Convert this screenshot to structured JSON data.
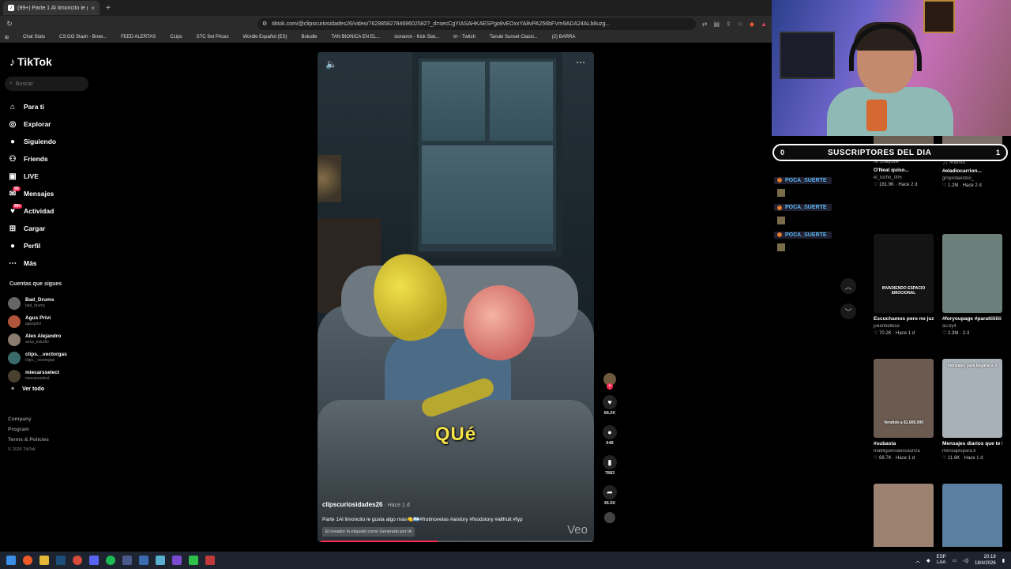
{
  "browser": {
    "tab_title": "(99+) Parte 1 Al limoncito le g...",
    "tab_close": "×",
    "new_tab": "+",
    "url": "tiktok.com/@clipscuriosidades26/video/7629858278469602582?_d=secCgYIASAHKAESPgo8vEOxxYA8vPA256bFVm9ADA24ALb8uzg...",
    "bookmarks": [
      {
        "label": "Chat Stats",
        "color": "#6a5acd"
      },
      {
        "label": "CS:GO Stash - Brow...",
        "color": "#e0a020"
      },
      {
        "label": "FEED ALERTAS",
        "color": "#e04040"
      },
      {
        "label": "CLips",
        "color": "#4a6ad0"
      },
      {
        "label": "STC Set Prices",
        "color": "#40a0c0"
      },
      {
        "label": "Wordle Español (ES)",
        "color": "#60b040"
      },
      {
        "label": "Boludle",
        "color": "#4090e0"
      },
      {
        "label": "TAN BIONICA EN EL...",
        "color": "#e04060"
      },
      {
        "label": "sionaron - Kick Stat...",
        "color": "#50c050"
      },
      {
        "label": "trr - Twitch",
        "color": "#9146ff"
      },
      {
        "label": "Tanuki Sunset Classi...",
        "color": "#e09040"
      },
      {
        "label": "(2) BARRA",
        "color": "#e03030"
      }
    ]
  },
  "tiktok": {
    "logo": "TikTok",
    "search_placeholder": "Buscar",
    "nav": [
      {
        "label": "Para ti",
        "icon": "home-icon",
        "glyph": "⌂",
        "name": "nav-for-you"
      },
      {
        "label": "Explorar",
        "icon": "compass-icon",
        "glyph": "◎",
        "name": "nav-explore"
      },
      {
        "label": "Siguiendo",
        "icon": "following-avatar-icon",
        "glyph": "●",
        "name": "nav-following"
      },
      {
        "label": "Friends",
        "icon": "friends-icon",
        "glyph": "⚇",
        "name": "nav-friends"
      },
      {
        "label": "LIVE",
        "icon": "live-icon",
        "glyph": "▣",
        "name": "nav-live"
      },
      {
        "label": "Mensajes",
        "icon": "messages-icon",
        "glyph": "✉",
        "name": "nav-messages",
        "badge": "99"
      },
      {
        "label": "Actividad",
        "icon": "activity-icon",
        "glyph": "♥",
        "name": "nav-activity",
        "badge": "99+"
      },
      {
        "label": "Cargar",
        "icon": "upload-icon",
        "glyph": "⊞",
        "name": "nav-upload"
      },
      {
        "label": "Perfil",
        "icon": "profile-avatar-icon",
        "glyph": "●",
        "name": "nav-profile"
      },
      {
        "label": "Más",
        "icon": "more-icon",
        "glyph": "⋯",
        "name": "nav-more"
      }
    ],
    "following_title": "Cuentas que sigues",
    "following": [
      {
        "name": "Bad_Drums",
        "handle": "bad_drums",
        "color": "#666"
      },
      {
        "name": "Agus Privi",
        "handle": "agusprivi",
        "color": "#b0553a"
      },
      {
        "name": "Alex Alejandro",
        "handle": "aoca_estudio",
        "color": "#8a7c6e"
      },
      {
        "name": "clips._.vectorgas",
        "handle": "clips._.vectorgas",
        "color": "#3a6a6a"
      },
      {
        "name": "miecarsselect",
        "handle": "miecarsselect",
        "color": "#4a4030"
      }
    ],
    "see_all": "Ver todo",
    "footer": [
      "Company",
      "Program",
      "Terms & Policies"
    ],
    "copyright": "© 2026 TikTok"
  },
  "video": {
    "caption_overlay": "QUé",
    "author": "clipscuriosidades26",
    "time": " · Hace 1 d",
    "description": "Parte 1Al limoncito le gusta algo mas🍋🇦🇷#frutinovelas #aistory #foodstory #allfruit #fyp",
    "ai_label": "El creador lo etiquetó como Generado por IA",
    "watermark": "Veo",
    "progress_fraction": 0.43,
    "likes": "68.2K",
    "comments": "648",
    "saves": "7883",
    "shares": "46.5K"
  },
  "stream": {
    "subs_count": "0",
    "subs_title": "SUSCRIPTORES DEL DIA",
    "subs_end": "1",
    "chat": [
      {
        "user": "POCA_SUERTE"
      },
      {
        "user": "POCA_SUERTE"
      },
      {
        "user": "POCA_SUERTE"
      }
    ]
  },
  "grid": [
    {
      "caption": "O'Neal quiso...",
      "author": "el_lucho_005",
      "stats": "♡ 181.9K · Hace 2 d",
      "top": "Ni Shaquille",
      "color": "#6b5e53"
    },
    {
      "caption": "#eladiocarrion...",
      "author": "grnjordaestoo_",
      "stats": "♡ 1.2M · Hace 2 d",
      "top": "🎵 #humor",
      "color": "#7b6f69"
    },
    {
      "caption": "Escuchamos pero no juzgamos.. 😂...",
      "author": "julianbellese",
      "stats": "♡ 70.2K · Hace 1 d",
      "overlay": "INVADIENDO ESPACIO EMOCIONAL",
      "color": "#141414"
    },
    {
      "caption": "#foryoupage #paratiiiiiiii #fy...",
      "author": "au.ky4",
      "stats": "♡ 2.3M · 2-3",
      "color": "#6d7f7a"
    },
    {
      "caption": "#subasta",
      "author": "matifigueroaescauriza",
      "stats": "♡ 68.7K · Hace 1 d",
      "overlay": "Vendido a $1.600.000",
      "color": "#6a5a50"
    },
    {
      "caption": "Mensajes diarios que te llegan",
      "author": "mensajespara.ti",
      "stats": "♡ 11.8K · Hace 1 d",
      "overlay": "mensajes para llegarte a ti",
      "color": "#a9b1b8"
    },
    {
      "caption": "",
      "author": "",
      "stats": "",
      "color": "#9c8270"
    },
    {
      "caption": "",
      "author": "",
      "stats": "",
      "color": "#5b7fa0"
    }
  ],
  "taskbar": {
    "lang": "ESP",
    "lang2": "LAA",
    "time": "20:19",
    "date": "18/4/2026"
  }
}
